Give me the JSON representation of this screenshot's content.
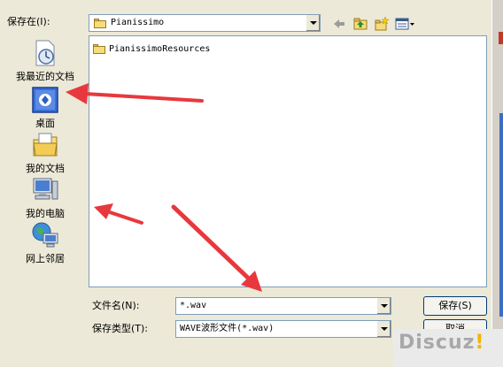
{
  "dialog": {
    "save_in_label": "保存在(I):",
    "save_in_value": "Pianissimo",
    "toolbar_icons": [
      "back-arrow-icon",
      "up-folder-icon",
      "new-folder-icon",
      "view-menu-icon"
    ]
  },
  "places": [
    {
      "label": "我最近的文档",
      "icon": "recent-documents-icon"
    },
    {
      "label": "桌面",
      "icon": "desktop-icon"
    },
    {
      "label": "我的文档",
      "icon": "my-documents-icon"
    },
    {
      "label": "我的电脑",
      "icon": "my-computer-icon"
    },
    {
      "label": "网上邻居",
      "icon": "network-places-icon"
    }
  ],
  "files": [
    {
      "name": "PianissimoResources",
      "icon": "folder-icon"
    }
  ],
  "filename": {
    "label": "文件名(N):",
    "value": "*.wav"
  },
  "filetype": {
    "label": "保存类型(T):",
    "value": "WAVE波形文件(*.wav)"
  },
  "buttons": {
    "save": "保存(S)",
    "cancel": "取消"
  },
  "watermark": {
    "text": "Discuz",
    "mark": "!"
  },
  "colors": {
    "dialog_bg": "#ece9d8",
    "arrow": "#e8383d",
    "folder": "#f7dd7a",
    "border": "#7f9db9"
  }
}
